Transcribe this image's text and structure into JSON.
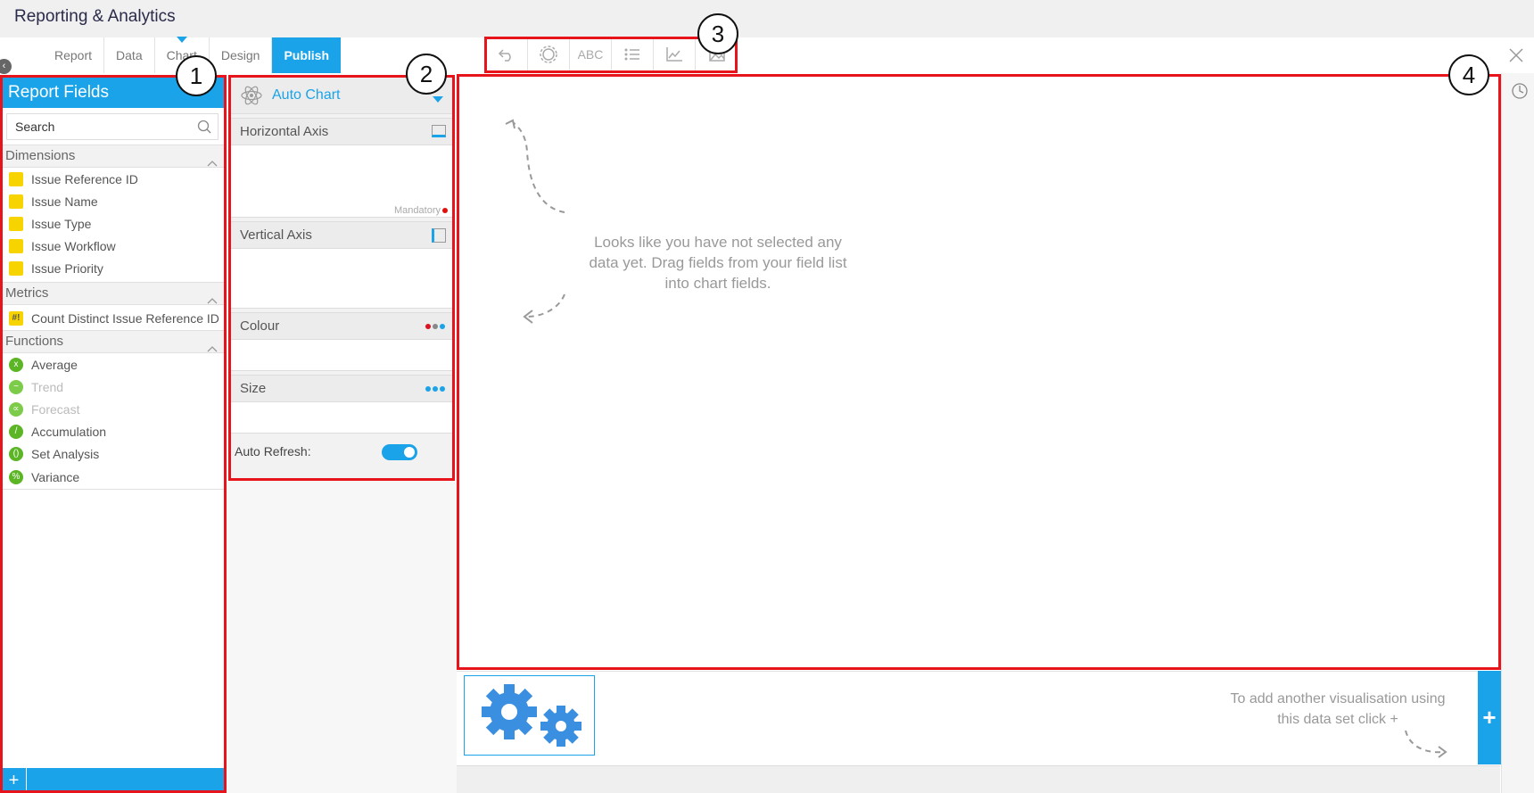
{
  "app": {
    "title": "Reporting & Analytics"
  },
  "tabs": [
    {
      "label": "Report"
    },
    {
      "label": "Data"
    },
    {
      "label": "Chart"
    },
    {
      "label": "Design"
    },
    {
      "label": "Publish"
    }
  ],
  "toolbar": {
    "tools": [
      {
        "icon": "undo-icon"
      },
      {
        "icon": "settings-gear-icon"
      },
      {
        "icon": "text-abc-icon",
        "label": "ABC"
      },
      {
        "icon": "list-icon"
      },
      {
        "icon": "axis-chart-icon"
      },
      {
        "icon": "image-icon"
      }
    ]
  },
  "sidebar": {
    "title": "Report Fields",
    "search_placeholder": "Search",
    "dimensions": {
      "label": "Dimensions",
      "items": [
        {
          "label": "Issue Reference ID"
        },
        {
          "label": "Issue Name"
        },
        {
          "label": "Issue Type"
        },
        {
          "label": "Issue Workflow"
        },
        {
          "label": "Issue Priority"
        }
      ]
    },
    "metrics": {
      "label": "Metrics",
      "items": [
        {
          "label": "Count Distinct Issue Reference ID",
          "badge": "#!"
        }
      ]
    },
    "functions": {
      "label": "Functions",
      "items": [
        {
          "label": "Average",
          "glyph": "x"
        },
        {
          "label": "Trend",
          "glyph": "~"
        },
        {
          "label": "Forecast",
          "glyph": "∝"
        },
        {
          "label": "Accumulation",
          "glyph": "/"
        },
        {
          "label": "Set Analysis",
          "glyph": "()"
        },
        {
          "label": "Variance",
          "glyph": "%"
        }
      ]
    },
    "footer_add": "+"
  },
  "chart_fields": {
    "chart_type": "Auto Chart",
    "horizontal_axis": "Horizontal Axis",
    "mandatory": "Mandatory",
    "vertical_axis": "Vertical Axis",
    "colour": "Colour",
    "size": "Size",
    "auto_refresh": "Auto Refresh:",
    "auto_refresh_on": true
  },
  "canvas": {
    "empty_message": "Looks like you have not selected any data yet. Drag fields from your field list into chart fields."
  },
  "bottom": {
    "add_hint": "To add another visualisation using this data set click +",
    "add_button": "+"
  },
  "annotations": [
    "1",
    "2",
    "3",
    "4"
  ],
  "colors": {
    "accent": "#1aa3e8",
    "highlight": "#e8141c",
    "dimension": "#f7d300",
    "function": "#5bb524"
  }
}
